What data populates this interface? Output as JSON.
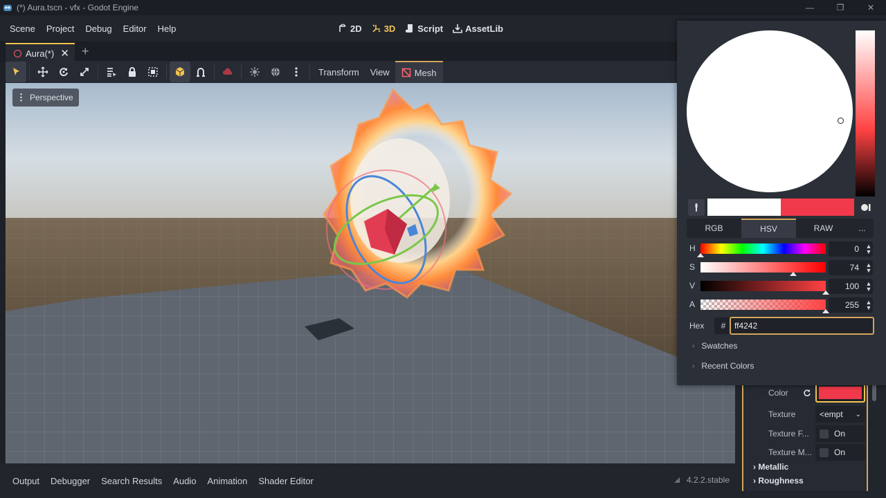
{
  "window": {
    "title": "(*) Aura.tscn - vfx - Godot Engine",
    "controls": [
      "—",
      "❐",
      "✕"
    ]
  },
  "menubar": {
    "items": [
      "Scene",
      "Project",
      "Debug",
      "Editor",
      "Help"
    ]
  },
  "workspaces": [
    {
      "label": "2D",
      "icon": "2d-icon",
      "active": false
    },
    {
      "label": "3D",
      "icon": "3d-icon",
      "active": true
    },
    {
      "label": "Script",
      "icon": "script-icon",
      "active": false
    },
    {
      "label": "AssetLib",
      "icon": "assetlib-icon",
      "active": false
    }
  ],
  "scene_tab": {
    "label": "Aura(*)",
    "close": "✕",
    "add": "+"
  },
  "toolbar": {
    "transform_label": "Transform",
    "view_label": "View",
    "mesh_label": "Mesh"
  },
  "viewport": {
    "perspective_label": "Perspective"
  },
  "color_picker": {
    "old_color": "#ffffff",
    "new_color": "#f0394a",
    "modes": [
      "RGB",
      "HSV",
      "RAW"
    ],
    "active_mode": "HSV",
    "more": "...",
    "sliders": [
      {
        "label": "H",
        "value": "0"
      },
      {
        "label": "S",
        "value": "74"
      },
      {
        "label": "V",
        "value": "100"
      },
      {
        "label": "A",
        "value": "255"
      }
    ],
    "hex_label": "Hex",
    "hash": "#",
    "hex_value": "ff4242",
    "swatches_label": "Swatches",
    "recent_label": "Recent Colors"
  },
  "inspector": {
    "color_label": "Color",
    "color_value": "#f0394a",
    "texture_label": "Texture",
    "texture_value": "<empt",
    "texture_f_label": "Texture F...",
    "texture_f_value": "On",
    "texture_m_label": "Texture M...",
    "texture_m_value": "On",
    "metallic_label": "Metallic",
    "roughness_label": "Roughness"
  },
  "bottom_tabs": [
    "Output",
    "Debugger",
    "Search Results",
    "Audio",
    "Animation",
    "Shader Editor"
  ],
  "version": "4.2.2.stable"
}
